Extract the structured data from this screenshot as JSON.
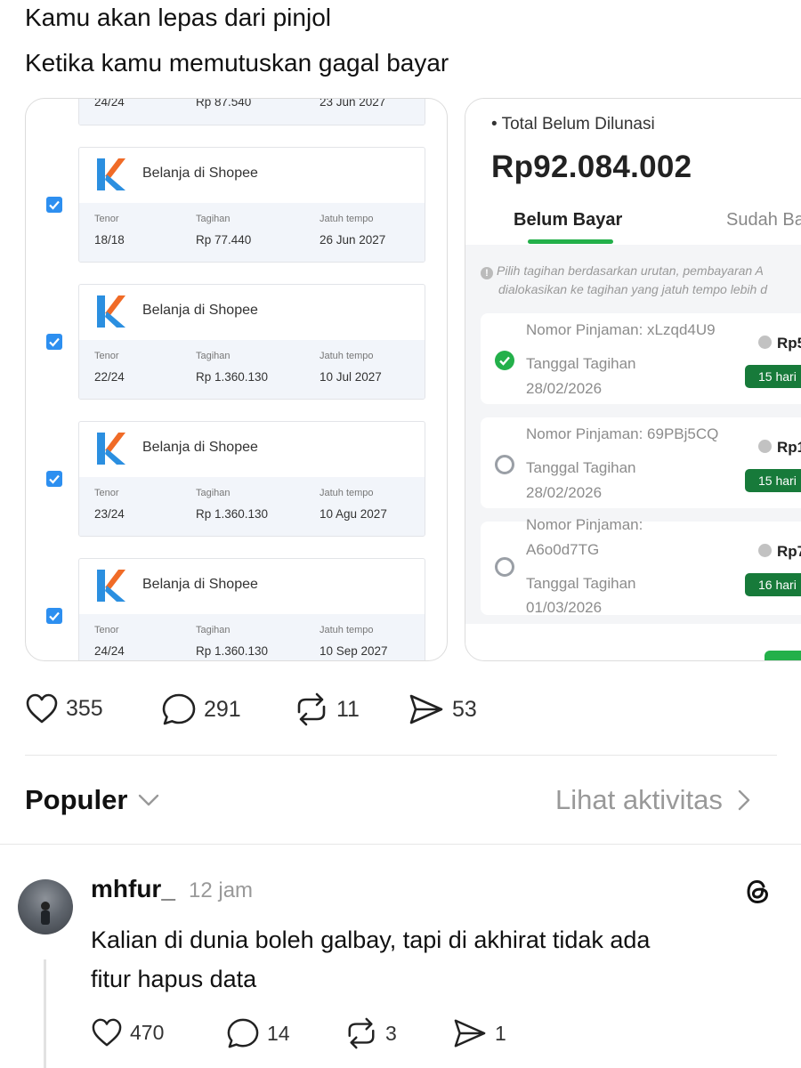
{
  "post": {
    "line1": "Kamu akan lepas dari pinjol",
    "line2": "Ketika kamu memutuskan gagal bayar"
  },
  "left_screenshot": {
    "partial_card": {
      "tenor": "24/24",
      "tagihan": "Rp 87.540",
      "jatuh_tempo": "23 Jun 2027"
    },
    "labels": {
      "tenor": "Tenor",
      "tagihan": "Tagihan",
      "jatuh_tempo": "Jatuh tempo"
    },
    "cards": [
      {
        "merchant": "Belanja di Shopee",
        "tenor": "18/18",
        "tagihan": "Rp 77.440",
        "jatuh_tempo": "26 Jun 2027",
        "checked": true
      },
      {
        "merchant": "Belanja di Shopee",
        "tenor": "22/24",
        "tagihan": "Rp 1.360.130",
        "jatuh_tempo": "10 Jul 2027",
        "checked": true
      },
      {
        "merchant": "Belanja di Shopee",
        "tenor": "23/24",
        "tagihan": "Rp 1.360.130",
        "jatuh_tempo": "10 Agu 2027",
        "checked": true
      },
      {
        "merchant": "Belanja di Shopee",
        "tenor": "24/24",
        "tagihan": "Rp 1.360.130",
        "jatuh_tempo": "10 Sep 2027",
        "checked": true
      }
    ]
  },
  "right_screenshot": {
    "total_label": "• Total Belum Dilunasi",
    "total_amount": "Rp92.084.002",
    "tabs": [
      "Belum Bayar",
      "Sudah Ba"
    ],
    "hint_line1": "Pilih tagihan berdasarkan urutan, pembayaran A",
    "hint_line2": "dialokasikan ke tagihan yang jatuh tempo lebih d",
    "loans": [
      {
        "nomor": "Nomor Pinjaman: xLzqd4U9",
        "tanggal_label": "Tanggal Tagihan",
        "tanggal": "28/02/2026",
        "amount": "Rp5",
        "badge": "15 hari",
        "selected": true
      },
      {
        "nomor": "Nomor Pinjaman: 69PBj5CQ",
        "tanggal_label": "Tanggal Tagihan",
        "tanggal": "28/02/2026",
        "amount": "Rp1.",
        "badge": "15 hari",
        "selected": false
      },
      {
        "nomor_line1": "Nomor Pinjaman:",
        "nomor_line2": "A6o0d7TG",
        "tanggal_label": "Tanggal Tagihan",
        "tanggal": "01/03/2026",
        "amount": "Rp7",
        "badge": "16 hari",
        "selected": false
      }
    ]
  },
  "post_actions": {
    "likes": "355",
    "comments": "291",
    "reposts": "11",
    "shares": "53"
  },
  "sort": {
    "label": "Populer",
    "activity_link": "Lihat aktivitas"
  },
  "reply": {
    "username": "mhfur_",
    "time": "12 jam",
    "text_line1": "Kalian di dunia boleh galbay, tapi di akhirat tidak ada",
    "text_line2": "fitur hapus data",
    "actions": {
      "likes": "470",
      "comments": "14",
      "reposts": "3",
      "shares": "1"
    }
  }
}
